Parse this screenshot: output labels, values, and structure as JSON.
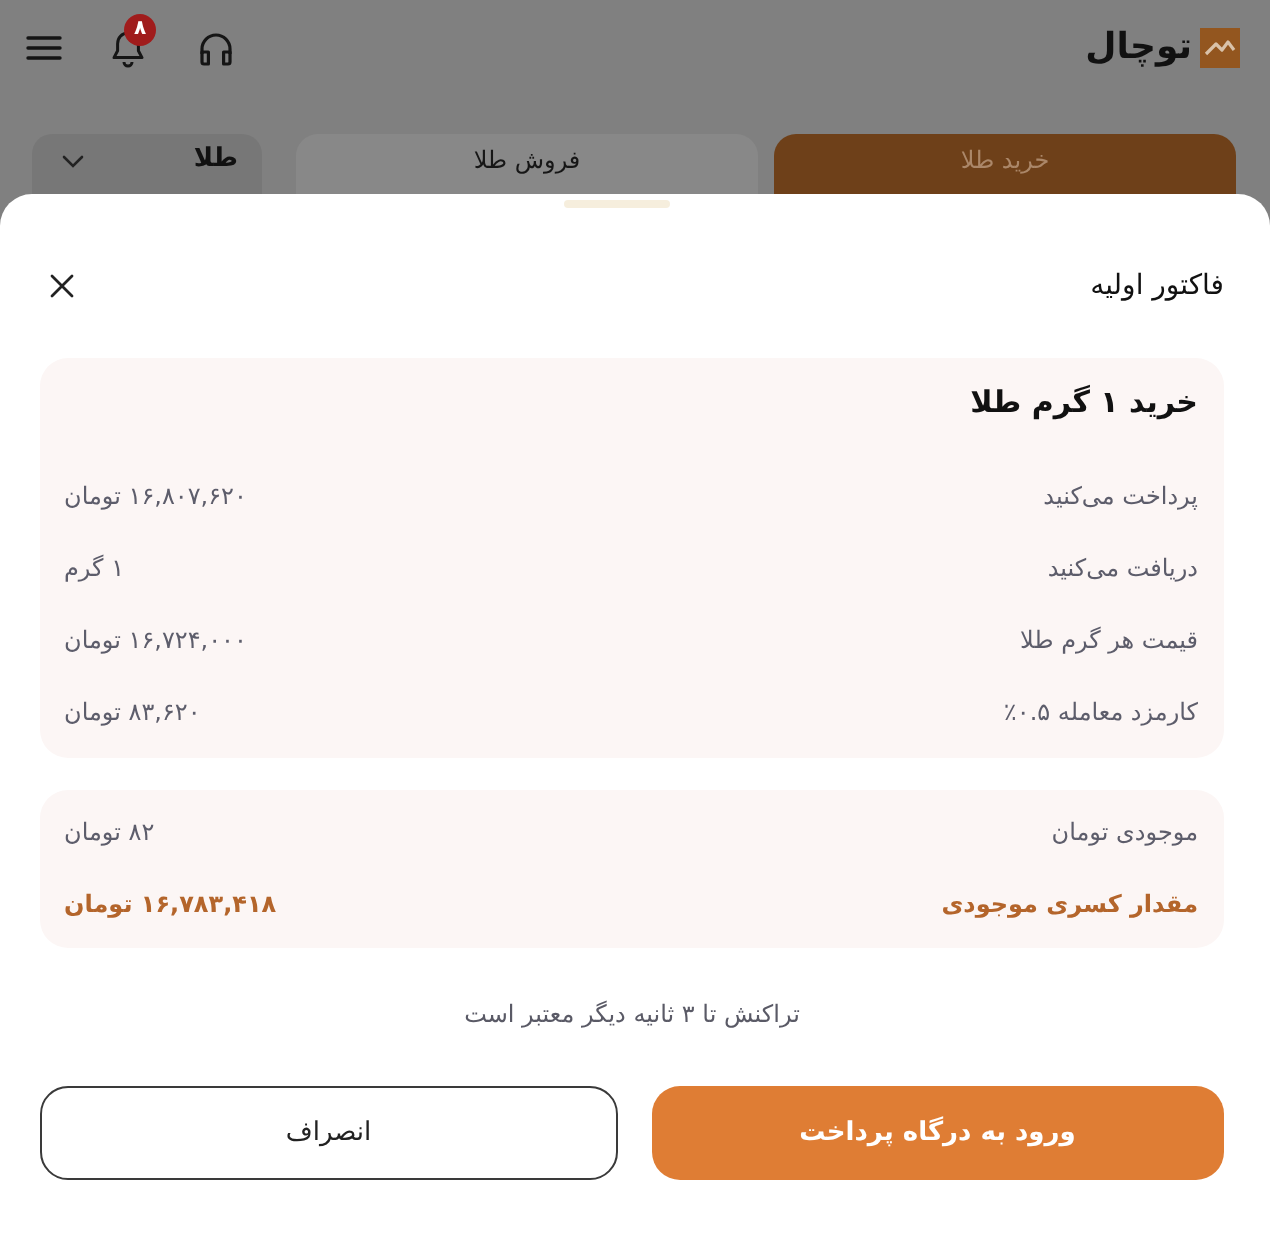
{
  "header": {
    "brand": "توچال",
    "notification_count": "۸"
  },
  "tabs": [
    {
      "label": "خرید طلا",
      "selected": true
    },
    {
      "label": "فروش طلا",
      "selected": false
    }
  ],
  "asset_select": {
    "value": "طلا"
  },
  "sheet": {
    "title": "فاکتور اولیه",
    "summary": {
      "heading": "خرید ۱ گرم طلا",
      "rows": [
        {
          "label": "پرداخت می‌کنید",
          "value": "۱۶,۸۰۷,۶۲۰ تومان"
        },
        {
          "label": "دریافت می‌کنید",
          "value": "۱ گرم"
        },
        {
          "label": "قیمت هر گرم طلا",
          "value": "۱۶,۷۲۴,۰۰۰ تومان"
        },
        {
          "label": "کارمزد معامله ۰.۵٪",
          "value": "۸۳,۶۲۰ تومان"
        }
      ]
    },
    "balance": {
      "rows": [
        {
          "label": "موجودی تومان",
          "value": "۸۲ تومان",
          "highlighted": false
        },
        {
          "label": "مقدار کسری موجودی",
          "value": "۱۶,۷۸۳,۴۱۸ تومان",
          "highlighted": true
        }
      ]
    },
    "note": "تراکنش تا ۳ ثانیه دیگر معتبر است",
    "buttons": [
      {
        "label": "ورود به درگاه پرداخت",
        "kind": "primary"
      },
      {
        "label": "انصراف",
        "kind": "secondary"
      }
    ]
  }
}
